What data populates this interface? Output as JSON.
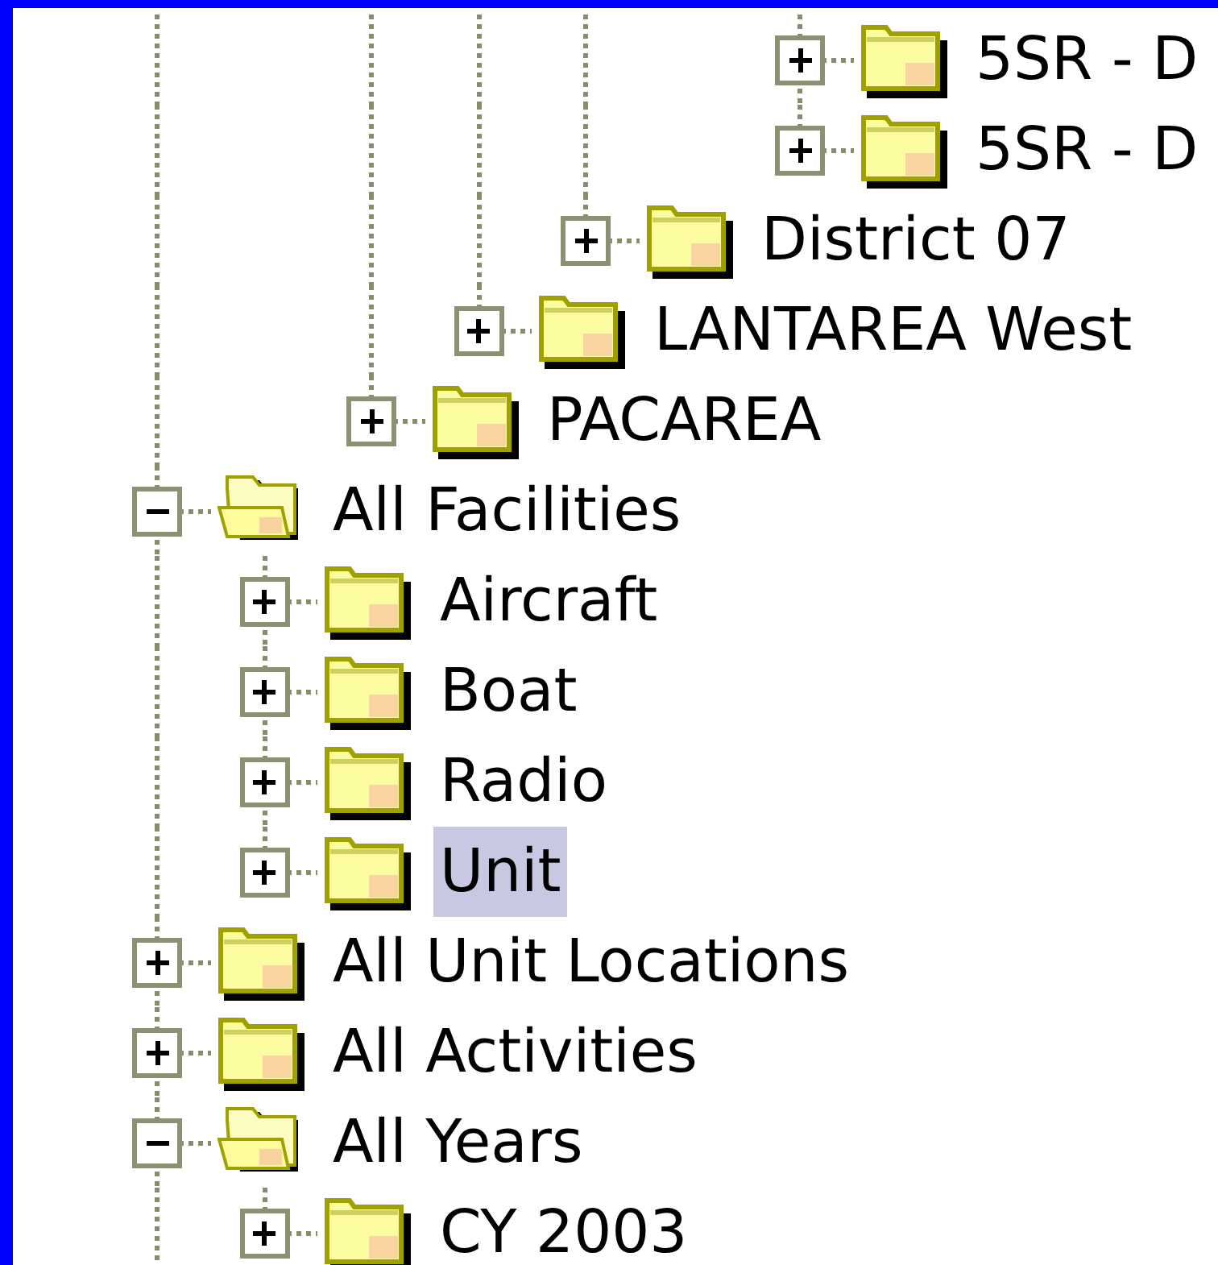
{
  "tree": [
    {
      "children": [
        {
          "children": [
            {
              "children": [
                {
                  "children": [
                    {
                      "children": [
                        {
                          "children": [
                            {
                              "label": "5SR - D",
                              "expanded": false,
                              "selected": false
                            },
                            {
                              "label": "5SR - D",
                              "expanded": false,
                              "selected": false
                            }
                          ]
                        }
                      ]
                    },
                    {
                      "label": "District 07",
                      "expanded": false,
                      "selected": false
                    }
                  ]
                },
                {
                  "label": "LANTAREA West",
                  "expanded": false,
                  "selected": false
                }
              ]
            },
            {
              "label": "PACAREA",
              "expanded": false,
              "selected": false
            }
          ]
        }
      ]
    },
    {
      "label": "All Facilities",
      "expanded": true,
      "selected": false,
      "children": [
        {
          "label": "Aircraft",
          "expanded": false,
          "selected": false
        },
        {
          "label": "Boat",
          "expanded": false,
          "selected": false
        },
        {
          "label": "Radio",
          "expanded": false,
          "selected": false
        },
        {
          "label": "Unit",
          "expanded": false,
          "selected": true
        }
      ]
    },
    {
      "label": "All Unit Locations",
      "expanded": false,
      "selected": false
    },
    {
      "label": "All Activities",
      "expanded": false,
      "selected": false
    },
    {
      "label": "All Years",
      "expanded": true,
      "selected": false,
      "continues": true,
      "children": [
        {
          "label": "CY 2003",
          "expanded": false,
          "selected": false
        }
      ]
    }
  ]
}
